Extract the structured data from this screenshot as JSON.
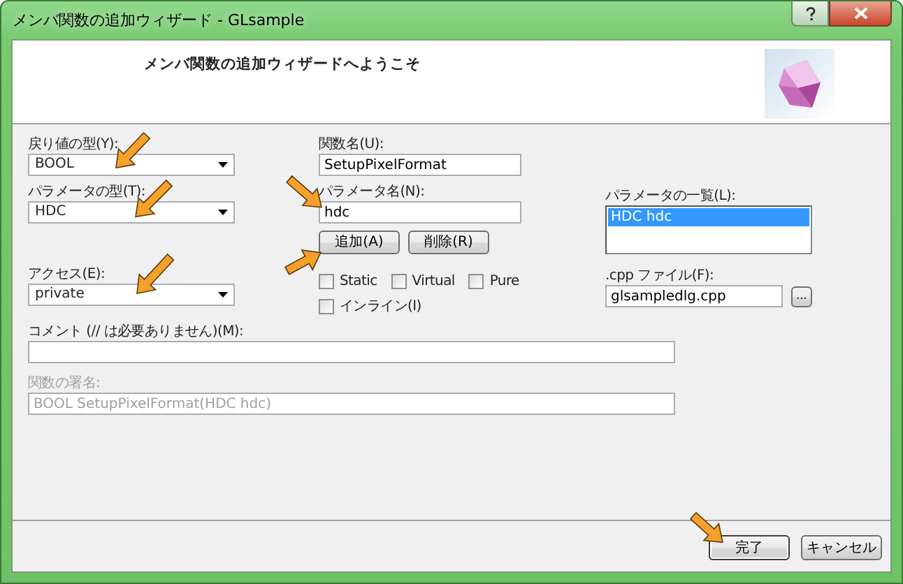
{
  "window": {
    "title": "メンバ関数の追加ウィザード - GLsample"
  },
  "header": {
    "title": "メンバ関数の追加ウィザードへようこそ"
  },
  "return_type": {
    "label": "戻り値の型(Y):",
    "value": "BOOL"
  },
  "parameter_type": {
    "label": "パラメータの型(T):",
    "value": "HDC"
  },
  "access": {
    "label": "アクセス(E):",
    "value": "private"
  },
  "function_name": {
    "label": "関数名(U):",
    "value": "SetupPixelFormat"
  },
  "parameter_name": {
    "label": "パラメータ名(N):",
    "value": "hdc"
  },
  "parameter_buttons": [
    "追加(A)",
    "削除(R)"
  ],
  "options": [
    {
      "label": "Static",
      "checked": false
    },
    {
      "label": "Virtual",
      "checked": false
    },
    {
      "label": "Pure",
      "checked": false
    },
    {
      "label": "インライン(I)",
      "checked": false
    }
  ],
  "parameter_list": {
    "label": "パラメータの一覧(L):",
    "items": [
      {
        "text": "HDC hdc",
        "selected": true
      }
    ]
  },
  "cpp_file": {
    "label": ".cpp ファイル(F):",
    "value": "glsampledlg.cpp",
    "browse_button": "..."
  },
  "comment": {
    "label": "コメント (// は必要ありません)(M):"
  },
  "signature": {
    "label": "関数の署名:",
    "value": "BOOL SetupPixelFormat(HDC hdc)",
    "disabled": true
  },
  "buttons": [
    {
      "label": "完了",
      "default": true
    },
    {
      "label": "キャンセル",
      "default": false
    }
  ]
}
